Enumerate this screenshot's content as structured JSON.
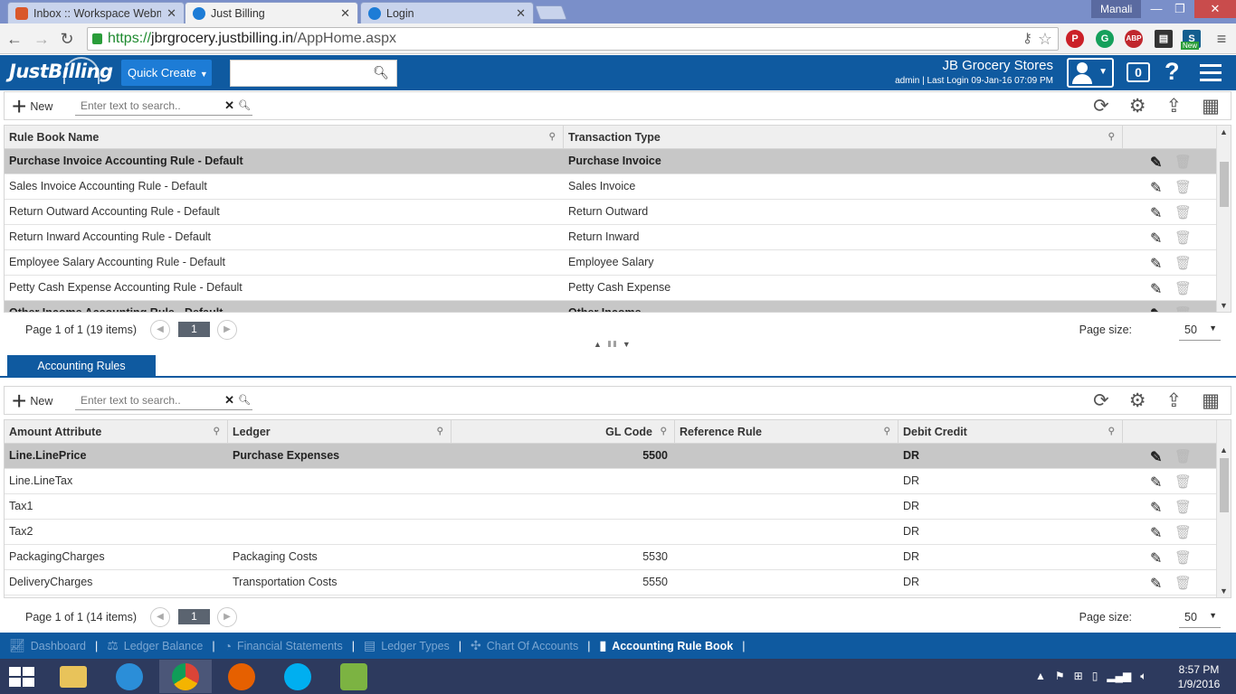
{
  "browser": {
    "tabs": [
      {
        "label": "Inbox :: Workspace Webm",
        "active": false
      },
      {
        "label": "Just Billing",
        "active": true
      },
      {
        "label": "Login",
        "active": false
      }
    ],
    "window_user": "Manali",
    "address": {
      "scheme": "https://",
      "host": "jbrgrocery.justbilling.in",
      "path": "/AppHome.aspx"
    },
    "ext_new_badge": "New"
  },
  "app": {
    "logo": "JustBilling",
    "quick_create": "Quick Create",
    "company": "JB Grocery Stores",
    "last_login": "admin | Last Login 09-Jan-16 07:09 PM",
    "notifications": "0",
    "brand_color": "#0f5aa0"
  },
  "top_grid": {
    "toolbar": {
      "new_label": "New",
      "search_placeholder": "Enter text to search.."
    },
    "columns": [
      "Rule Book Name",
      "Transaction Type"
    ],
    "rows": [
      {
        "name": "Purchase Invoice Accounting Rule - Default",
        "type": "Purchase Invoice",
        "selected": true
      },
      {
        "name": "Sales Invoice Accounting Rule - Default",
        "type": "Sales Invoice",
        "selected": false
      },
      {
        "name": "Return Outward Accounting Rule - Default",
        "type": "Return Outward",
        "selected": false
      },
      {
        "name": "Return Inward Accounting Rule - Default",
        "type": "Return Inward",
        "selected": false
      },
      {
        "name": "Employee Salary Accounting Rule - Default",
        "type": "Employee Salary",
        "selected": false
      },
      {
        "name": "Petty Cash Expense Accounting Rule - Default",
        "type": "Petty Cash Expense",
        "selected": false
      },
      {
        "name": "Other Income Accounting Rule - Default",
        "type": "Other Income",
        "selected": true
      }
    ],
    "pager": {
      "info": "Page 1 of 1 (19 items)",
      "page": "1",
      "page_size_label": "Page size:",
      "page_size": "50"
    }
  },
  "panel_tab": "Accounting Rules",
  "bottom_grid": {
    "toolbar": {
      "new_label": "New",
      "search_placeholder": "Enter text to search.."
    },
    "columns": [
      "Amount Attribute",
      "Ledger",
      "GL Code",
      "Reference Rule",
      "Debit Credit"
    ],
    "rows": [
      {
        "attr": "Line.LinePrice",
        "ledger": "Purchase Expenses",
        "gl": "5500",
        "ref": "",
        "dc": "DR",
        "selected": true
      },
      {
        "attr": "Line.LineTax",
        "ledger": "",
        "gl": "",
        "ref": "",
        "dc": "DR",
        "selected": false
      },
      {
        "attr": "Tax1",
        "ledger": "",
        "gl": "",
        "ref": "",
        "dc": "DR",
        "selected": false
      },
      {
        "attr": "Tax2",
        "ledger": "",
        "gl": "",
        "ref": "",
        "dc": "DR",
        "selected": false
      },
      {
        "attr": "PackagingCharges",
        "ledger": "Packaging Costs",
        "gl": "5530",
        "ref": "",
        "dc": "DR",
        "selected": false
      },
      {
        "attr": "DeliveryCharges",
        "ledger": "Transportation Costs",
        "gl": "5550",
        "ref": "",
        "dc": "DR",
        "selected": false
      }
    ],
    "pager": {
      "info": "Page 1 of 1 (14 items)",
      "page": "1",
      "page_size_label": "Page size:",
      "page_size": "50"
    }
  },
  "footer_nav": [
    {
      "label": "Dashboard",
      "icon": "chart-line-icon",
      "current": false
    },
    {
      "label": "Ledger Balance",
      "icon": "scale-icon",
      "current": false
    },
    {
      "label": "Financial Statements",
      "icon": "pie-icon",
      "current": false
    },
    {
      "label": "Ledger Types",
      "icon": "ledger-icon",
      "current": false
    },
    {
      "label": "Chart Of Accounts",
      "icon": "network-icon",
      "current": false
    },
    {
      "label": "Accounting Rule Book",
      "icon": "book-icon",
      "current": true
    }
  ],
  "taskbar": {
    "time": "8:57 PM",
    "date": "1/9/2016"
  }
}
